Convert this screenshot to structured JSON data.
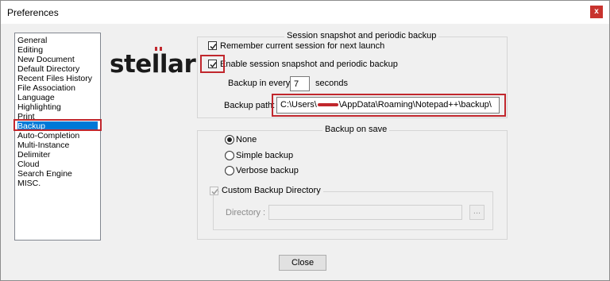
{
  "window": {
    "title": "Preferences",
    "close_glyph": "x"
  },
  "sidebar": {
    "items": [
      {
        "label": "General"
      },
      {
        "label": "Editing"
      },
      {
        "label": "New Document"
      },
      {
        "label": "Default Directory"
      },
      {
        "label": "Recent Files History"
      },
      {
        "label": "File Association"
      },
      {
        "label": "Language"
      },
      {
        "label": "Highlighting"
      },
      {
        "label": "Print"
      },
      {
        "label": "Backup",
        "selected": true
      },
      {
        "label": "Auto-Completion"
      },
      {
        "label": "Multi-Instance"
      },
      {
        "label": "Delimiter"
      },
      {
        "label": "Cloud"
      },
      {
        "label": "Search Engine"
      },
      {
        "label": "MISC."
      }
    ]
  },
  "logo": {
    "text": "stellar"
  },
  "session": {
    "group_title": "Session snapshot and periodic backup",
    "remember_label": "Remember current session for next launch",
    "remember_checked": true,
    "enable_label": "Enable session snapshot and periodic backup",
    "enable_checked": true,
    "backup_every_label": "Backup in every",
    "backup_every_value": "7",
    "seconds_label": "seconds",
    "backup_path_label": "Backup path:",
    "backup_path_prefix": "C:\\Users\\",
    "backup_path_suffix": "\\AppData\\Roaming\\Notepad++\\backup\\"
  },
  "backup_on_save": {
    "group_title": "Backup on save",
    "options": [
      {
        "label": "None",
        "selected": true
      },
      {
        "label": "Simple backup",
        "selected": false
      },
      {
        "label": "Verbose backup",
        "selected": false
      }
    ],
    "custom_dir_label": "Custom Backup Directory",
    "custom_dir_checked": true,
    "directory_label": "Directory :",
    "directory_value": "",
    "browse_label": "..."
  },
  "footer": {
    "close_label": "Close"
  },
  "colors": {
    "highlight": "#c1272d",
    "selection": "#0078d7"
  }
}
